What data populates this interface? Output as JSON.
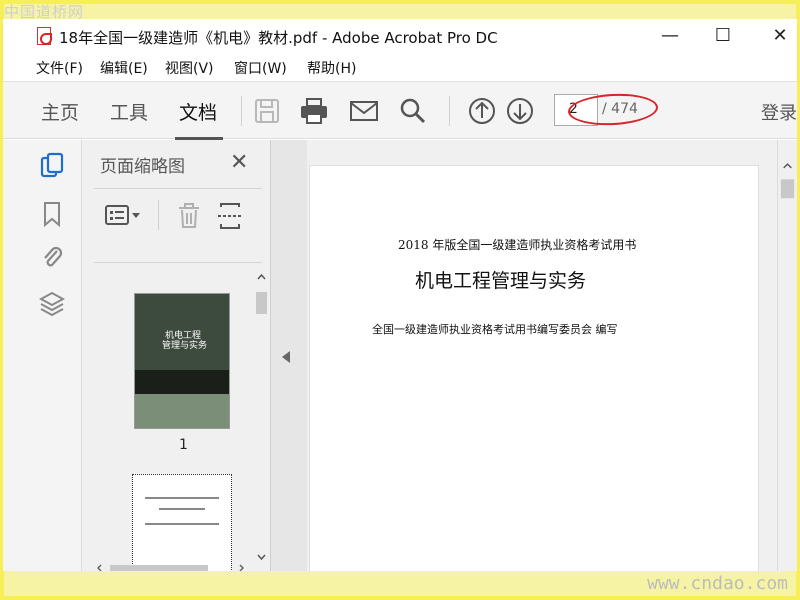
{
  "watermarks": {
    "top_left": "中国道桥网",
    "bottom_right": "www.cndao.com"
  },
  "window": {
    "title": "18年全国一级建造师《机电》教材.pdf - Adobe Acrobat Pro DC",
    "minimize": "—",
    "maximize": "☐",
    "close": "✕"
  },
  "menu": [
    "文件(F)",
    "编辑(E)",
    "视图(V)",
    "窗口(W)",
    "帮助(H)"
  ],
  "toolbar": {
    "tabs": [
      {
        "label": "主页",
        "active": false
      },
      {
        "label": "工具",
        "active": false
      },
      {
        "label": "文档",
        "active": true
      }
    ],
    "icons": [
      "save-icon",
      "print-icon",
      "mail-icon",
      "search-icon",
      "page-up-icon",
      "page-down-icon"
    ],
    "current_page": "2",
    "total_pages": "/ 474",
    "login": "登录",
    "annotation_color": "#d8232a"
  },
  "rail_icons": [
    "page-thumbnails-icon",
    "bookmark-icon",
    "attachment-icon",
    "layers-icon"
  ],
  "thumbnail_panel": {
    "title": "页面缩略图",
    "close": "✕",
    "thumbnails": [
      {
        "number": "1",
        "title_line1": "机电工程",
        "title_line2": "管理与实务"
      }
    ]
  },
  "document": {
    "line1": "2018 年版全国一级建造师执业资格考试用书",
    "line2": "机电工程管理与实务",
    "line3": "全国一级建造师执业资格考试用书编写委员会  编写"
  }
}
